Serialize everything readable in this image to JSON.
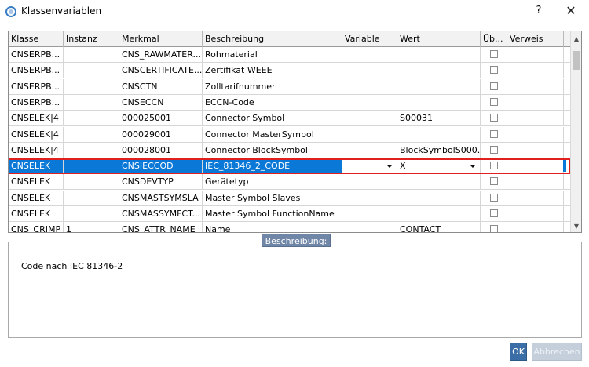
{
  "window": {
    "title": "Klassenvariablen",
    "help_label": "?",
    "close_label": "✕"
  },
  "table": {
    "columns": [
      "Klasse",
      "Instanz",
      "Merkmal",
      "Beschreibung",
      "Variable",
      "Wert",
      "Üb...",
      "Verweis"
    ],
    "rows": [
      {
        "klasse": "CNSERPB...",
        "instanz": "",
        "merkmal": "CNS_RAWMATER...",
        "beschreibung": "Rohmaterial",
        "variable": "",
        "wert": "",
        "ueb": false,
        "verweis": ""
      },
      {
        "klasse": "CNSERPB...",
        "instanz": "",
        "merkmal": "CNSCERTIFICATE...",
        "beschreibung": "Zertifikat WEEE",
        "variable": "",
        "wert": "",
        "ueb": false,
        "verweis": ""
      },
      {
        "klasse": "CNSERPB...",
        "instanz": "",
        "merkmal": "CNSCTN",
        "beschreibung": "Zolltarifnummer",
        "variable": "",
        "wert": "",
        "ueb": false,
        "verweis": ""
      },
      {
        "klasse": "CNSERPB...",
        "instanz": "",
        "merkmal": "CNSECCN",
        "beschreibung": "ECCN-Code",
        "variable": "",
        "wert": "",
        "ueb": false,
        "verweis": ""
      },
      {
        "klasse": "CNSELEK|4",
        "instanz": "",
        "merkmal": "000025001",
        "beschreibung": "Connector Symbol",
        "variable": "",
        "wert": "S00031",
        "ueb": false,
        "verweis": ""
      },
      {
        "klasse": "CNSELEK|4",
        "instanz": "",
        "merkmal": "000029001",
        "beschreibung": "Connector MasterSymbol",
        "variable": "",
        "wert": "",
        "ueb": false,
        "verweis": ""
      },
      {
        "klasse": "CNSELEK|4",
        "instanz": "",
        "merkmal": "000028001",
        "beschreibung": "Connector BlockSymbol",
        "variable": "",
        "wert": "BlockSymbolS000...",
        "ueb": false,
        "verweis": ""
      },
      {
        "klasse": "CNSELEK",
        "instanz": "",
        "merkmal": "CNSIECCOD",
        "beschreibung": "IEC_81346_2_CODE",
        "variable": "",
        "wert": "X",
        "ueb": false,
        "verweis": "",
        "selected": true
      },
      {
        "klasse": "CNSELEK",
        "instanz": "",
        "merkmal": "CNSDEVTYP",
        "beschreibung": "Gerätetyp",
        "variable": "",
        "wert": "",
        "ueb": false,
        "verweis": ""
      },
      {
        "klasse": "CNSELEK",
        "instanz": "",
        "merkmal": "CNSMASTSYMSLA",
        "beschreibung": "Master Symbol Slaves",
        "variable": "",
        "wert": "",
        "ueb": false,
        "verweis": ""
      },
      {
        "klasse": "CNSELEK",
        "instanz": "",
        "merkmal": "CNSMASSYMFCT...",
        "beschreibung": "Master Symbol FunctionName",
        "variable": "",
        "wert": "",
        "ueb": false,
        "verweis": ""
      },
      {
        "klasse": "CNS_CRIMP",
        "instanz": "1",
        "merkmal": "CNS_ATTR_NAME",
        "beschreibung": "Name",
        "variable": "",
        "wert": "CONTACT",
        "ueb": false,
        "verweis": ""
      }
    ]
  },
  "description": {
    "legend": "Beschreibung:",
    "text": "Code nach IEC 81346-2"
  },
  "buttons": {
    "ok": "OK",
    "cancel": "Abbrechen"
  },
  "colors": {
    "selection": "#0a78d7",
    "highlight_outline": "#e0201e",
    "ok_button": "#3b6ea6",
    "legend": "#6f86a6"
  }
}
